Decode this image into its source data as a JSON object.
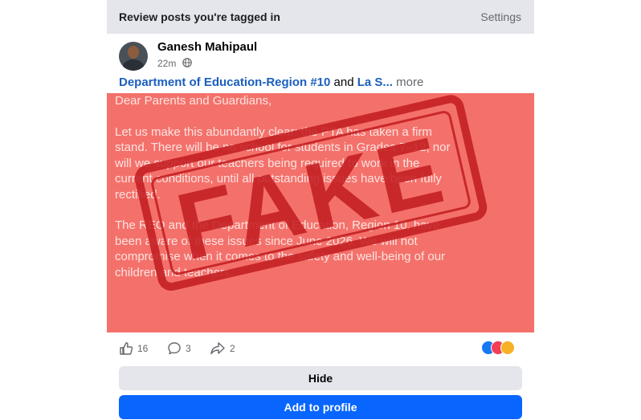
{
  "header": {
    "title": "Review posts you're tagged in",
    "settings_label": "Settings"
  },
  "post": {
    "author": "Ganesh Mahipaul",
    "time": "22m",
    "text_link_1": "Department of Education-Region #10",
    "text_and": " and ",
    "text_link_2": "La S...",
    "text_more": " more"
  },
  "image": {
    "stamp_text": "FAKE",
    "letter": {
      "greeting": "Dear Parents and Guardians,",
      "paragraph1": "Let us make this abundantly clear: the PTA has taken a firm stand. There will be no school for students in Grades 7–12, nor will we support our teachers being required to work in the current conditions, until all outstanding issues have been fully rectified.",
      "paragraph2": "The REO and the Department of Education, Region 10, have been aware of these issues since June 2026. We will not compromise when it comes to the safety and well-being of our children and teachers."
    },
    "background_color": "#f4716b",
    "stamp_color": "#c41e22"
  },
  "actions": {
    "likes": "16",
    "comments": "3",
    "shares": "2"
  },
  "buttons": {
    "hide_label": "Hide",
    "add_label": "Add to profile"
  },
  "colors": {
    "primary": "#0866ff",
    "link": "#1b5fbf",
    "secondary_bg": "#e4e6eb"
  }
}
